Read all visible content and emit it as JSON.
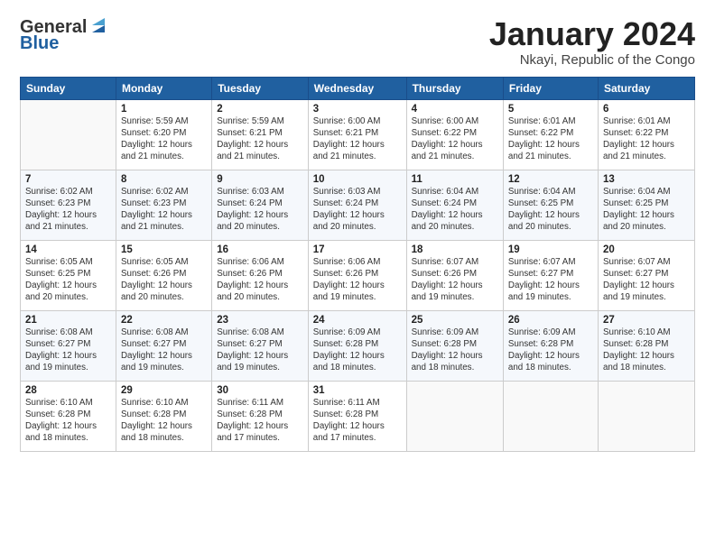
{
  "header": {
    "logo": {
      "general": "General",
      "blue": "Blue"
    },
    "title": "January 2024",
    "location": "Nkayi, Republic of the Congo"
  },
  "days_of_week": [
    "Sunday",
    "Monday",
    "Tuesday",
    "Wednesday",
    "Thursday",
    "Friday",
    "Saturday"
  ],
  "weeks": [
    [
      {
        "day": "",
        "info": ""
      },
      {
        "day": "1",
        "info": "Sunrise: 5:59 AM\nSunset: 6:20 PM\nDaylight: 12 hours\nand 21 minutes."
      },
      {
        "day": "2",
        "info": "Sunrise: 5:59 AM\nSunset: 6:21 PM\nDaylight: 12 hours\nand 21 minutes."
      },
      {
        "day": "3",
        "info": "Sunrise: 6:00 AM\nSunset: 6:21 PM\nDaylight: 12 hours\nand 21 minutes."
      },
      {
        "day": "4",
        "info": "Sunrise: 6:00 AM\nSunset: 6:22 PM\nDaylight: 12 hours\nand 21 minutes."
      },
      {
        "day": "5",
        "info": "Sunrise: 6:01 AM\nSunset: 6:22 PM\nDaylight: 12 hours\nand 21 minutes."
      },
      {
        "day": "6",
        "info": "Sunrise: 6:01 AM\nSunset: 6:22 PM\nDaylight: 12 hours\nand 21 minutes."
      }
    ],
    [
      {
        "day": "7",
        "info": "Sunrise: 6:02 AM\nSunset: 6:23 PM\nDaylight: 12 hours\nand 21 minutes."
      },
      {
        "day": "8",
        "info": "Sunrise: 6:02 AM\nSunset: 6:23 PM\nDaylight: 12 hours\nand 21 minutes."
      },
      {
        "day": "9",
        "info": "Sunrise: 6:03 AM\nSunset: 6:24 PM\nDaylight: 12 hours\nand 20 minutes."
      },
      {
        "day": "10",
        "info": "Sunrise: 6:03 AM\nSunset: 6:24 PM\nDaylight: 12 hours\nand 20 minutes."
      },
      {
        "day": "11",
        "info": "Sunrise: 6:04 AM\nSunset: 6:24 PM\nDaylight: 12 hours\nand 20 minutes."
      },
      {
        "day": "12",
        "info": "Sunrise: 6:04 AM\nSunset: 6:25 PM\nDaylight: 12 hours\nand 20 minutes."
      },
      {
        "day": "13",
        "info": "Sunrise: 6:04 AM\nSunset: 6:25 PM\nDaylight: 12 hours\nand 20 minutes."
      }
    ],
    [
      {
        "day": "14",
        "info": "Sunrise: 6:05 AM\nSunset: 6:25 PM\nDaylight: 12 hours\nand 20 minutes."
      },
      {
        "day": "15",
        "info": "Sunrise: 6:05 AM\nSunset: 6:26 PM\nDaylight: 12 hours\nand 20 minutes."
      },
      {
        "day": "16",
        "info": "Sunrise: 6:06 AM\nSunset: 6:26 PM\nDaylight: 12 hours\nand 20 minutes."
      },
      {
        "day": "17",
        "info": "Sunrise: 6:06 AM\nSunset: 6:26 PM\nDaylight: 12 hours\nand 19 minutes."
      },
      {
        "day": "18",
        "info": "Sunrise: 6:07 AM\nSunset: 6:26 PM\nDaylight: 12 hours\nand 19 minutes."
      },
      {
        "day": "19",
        "info": "Sunrise: 6:07 AM\nSunset: 6:27 PM\nDaylight: 12 hours\nand 19 minutes."
      },
      {
        "day": "20",
        "info": "Sunrise: 6:07 AM\nSunset: 6:27 PM\nDaylight: 12 hours\nand 19 minutes."
      }
    ],
    [
      {
        "day": "21",
        "info": "Sunrise: 6:08 AM\nSunset: 6:27 PM\nDaylight: 12 hours\nand 19 minutes."
      },
      {
        "day": "22",
        "info": "Sunrise: 6:08 AM\nSunset: 6:27 PM\nDaylight: 12 hours\nand 19 minutes."
      },
      {
        "day": "23",
        "info": "Sunrise: 6:08 AM\nSunset: 6:27 PM\nDaylight: 12 hours\nand 19 minutes."
      },
      {
        "day": "24",
        "info": "Sunrise: 6:09 AM\nSunset: 6:28 PM\nDaylight: 12 hours\nand 18 minutes."
      },
      {
        "day": "25",
        "info": "Sunrise: 6:09 AM\nSunset: 6:28 PM\nDaylight: 12 hours\nand 18 minutes."
      },
      {
        "day": "26",
        "info": "Sunrise: 6:09 AM\nSunset: 6:28 PM\nDaylight: 12 hours\nand 18 minutes."
      },
      {
        "day": "27",
        "info": "Sunrise: 6:10 AM\nSunset: 6:28 PM\nDaylight: 12 hours\nand 18 minutes."
      }
    ],
    [
      {
        "day": "28",
        "info": "Sunrise: 6:10 AM\nSunset: 6:28 PM\nDaylight: 12 hours\nand 18 minutes."
      },
      {
        "day": "29",
        "info": "Sunrise: 6:10 AM\nSunset: 6:28 PM\nDaylight: 12 hours\nand 18 minutes."
      },
      {
        "day": "30",
        "info": "Sunrise: 6:11 AM\nSunset: 6:28 PM\nDaylight: 12 hours\nand 17 minutes."
      },
      {
        "day": "31",
        "info": "Sunrise: 6:11 AM\nSunset: 6:28 PM\nDaylight: 12 hours\nand 17 minutes."
      },
      {
        "day": "",
        "info": ""
      },
      {
        "day": "",
        "info": ""
      },
      {
        "day": "",
        "info": ""
      }
    ]
  ]
}
